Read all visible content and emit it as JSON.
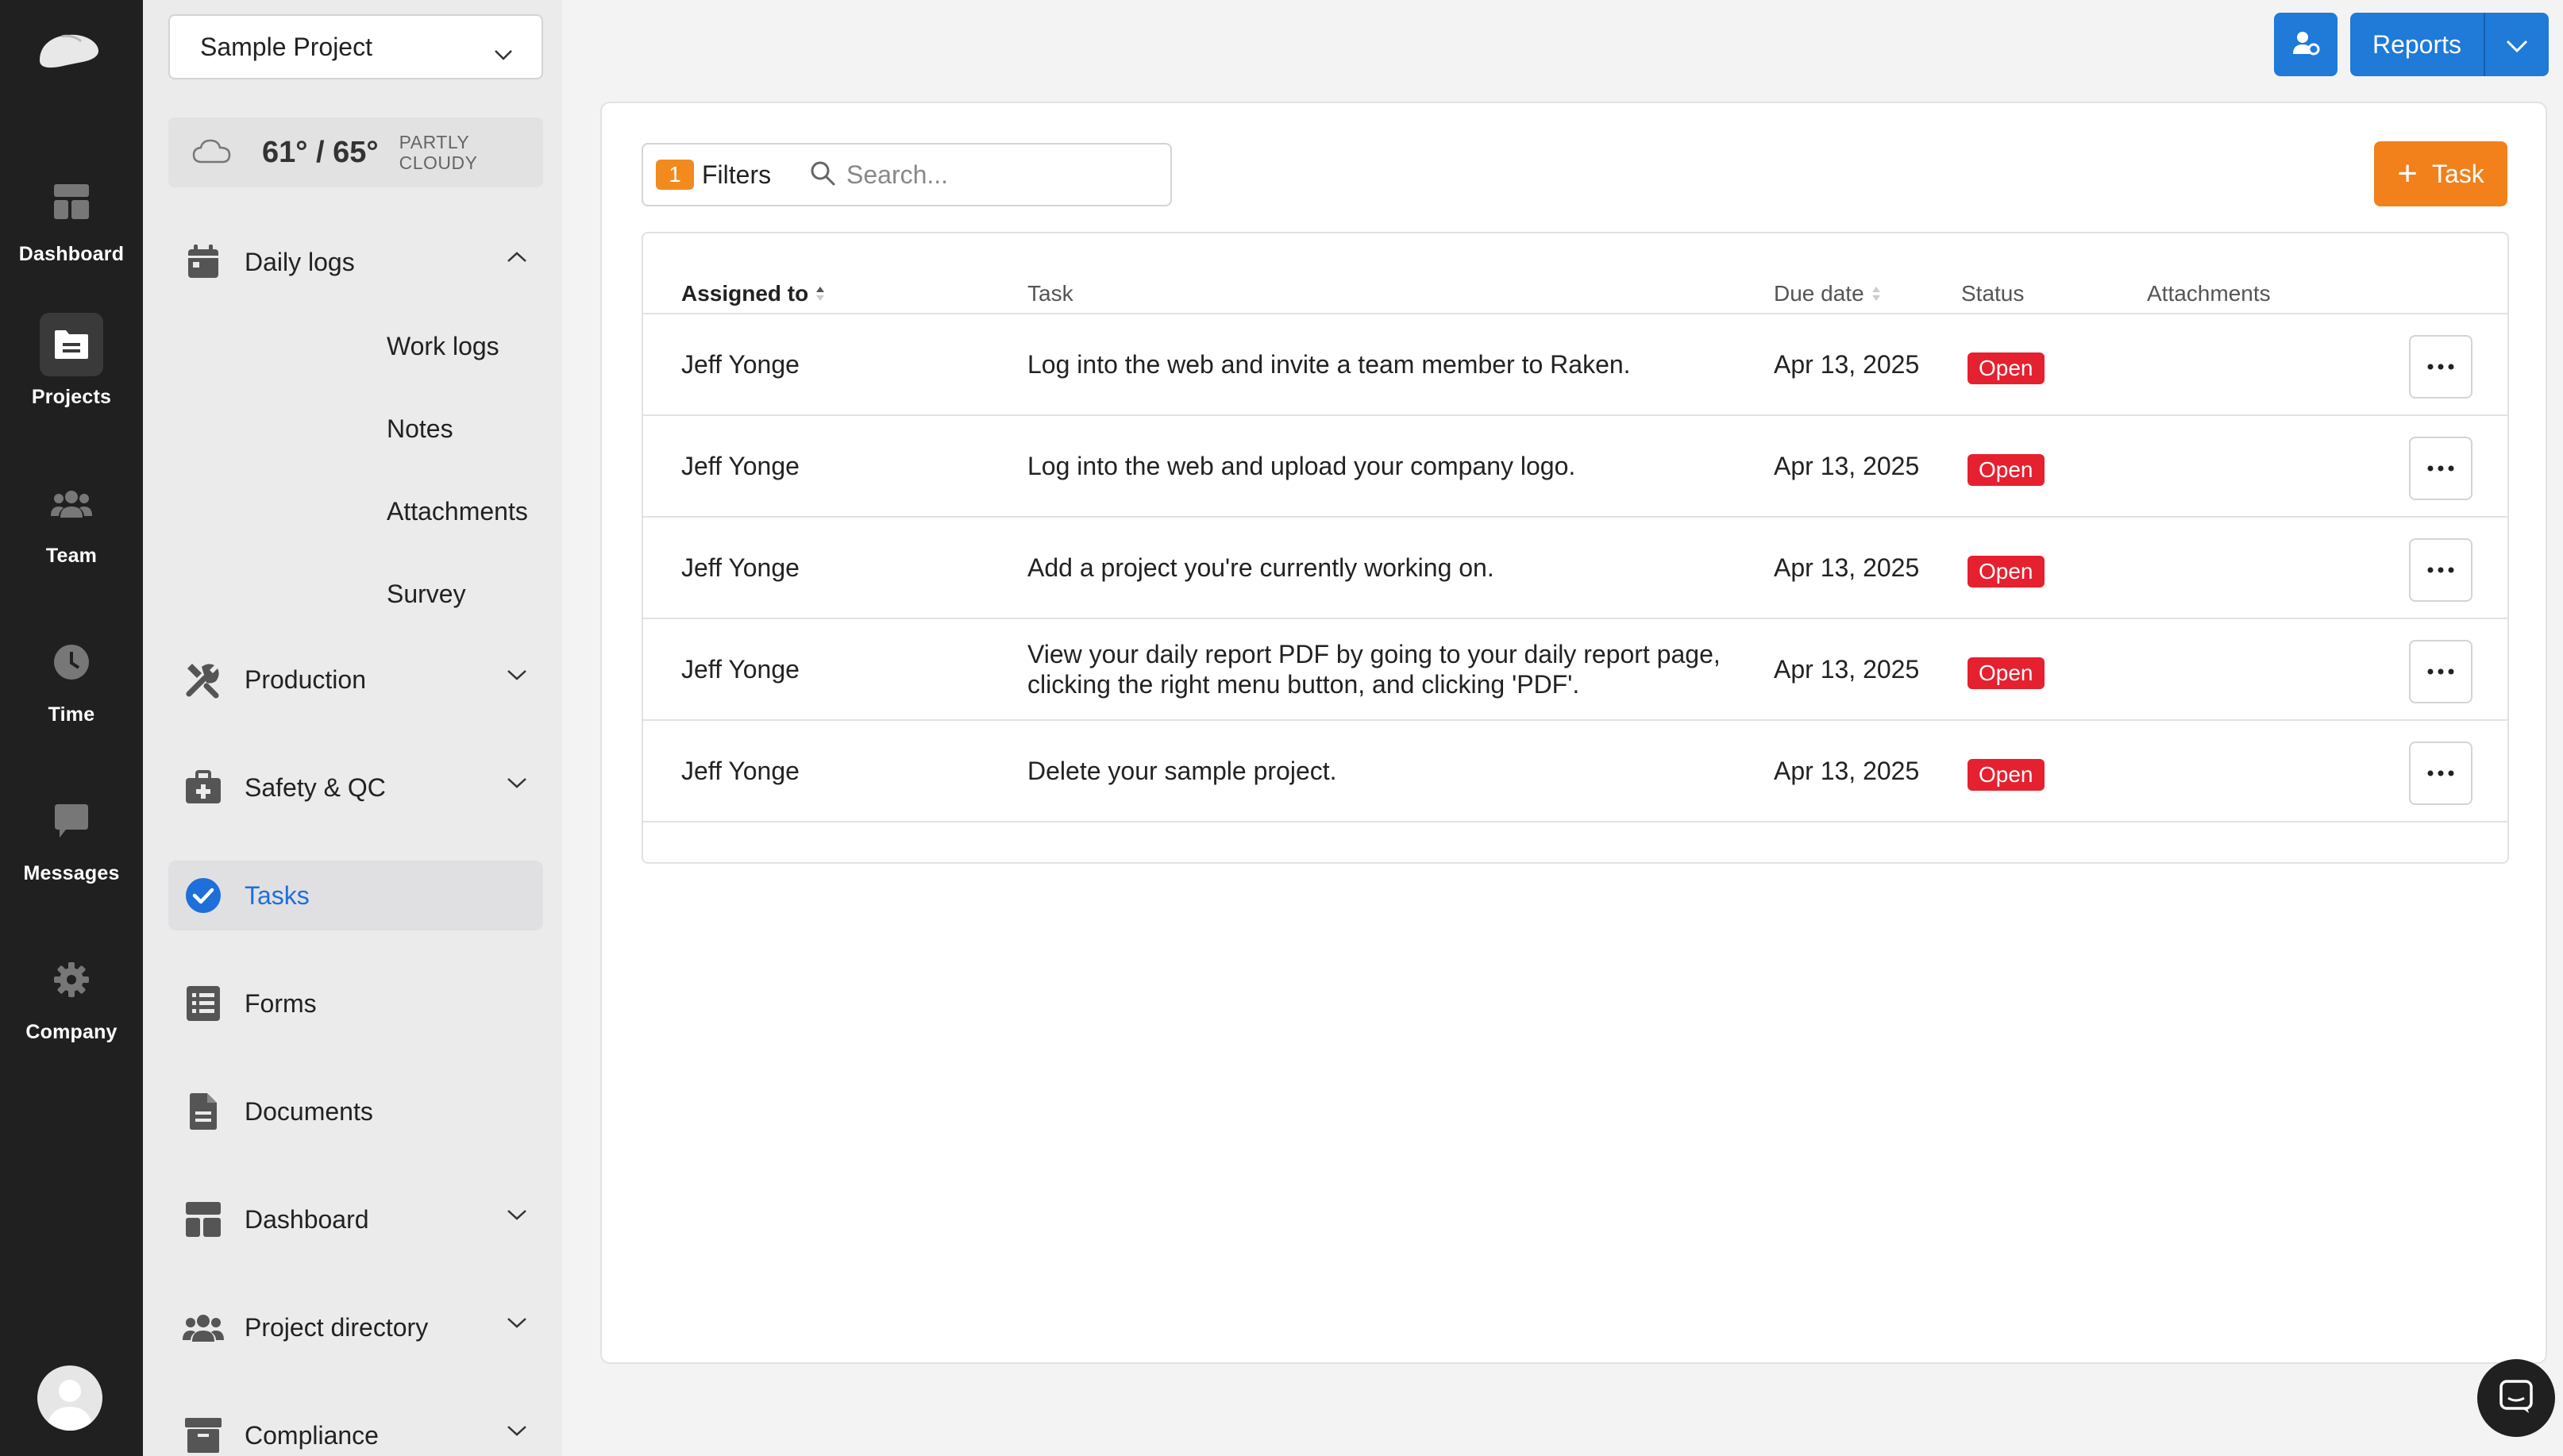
{
  "rail": {
    "items": [
      {
        "label": "Dashboard",
        "icon": "dashboard-icon"
      },
      {
        "label": "Projects",
        "icon": "folder-icon"
      },
      {
        "label": "Team",
        "icon": "team-icon"
      },
      {
        "label": "Time",
        "icon": "clock-icon"
      },
      {
        "label": "Messages",
        "icon": "chat-icon"
      },
      {
        "label": "Company",
        "icon": "gear-icon"
      }
    ],
    "active": "Projects"
  },
  "project": {
    "selected": "Sample Project"
  },
  "weather": {
    "temp": "61° / 65°",
    "condition": "PARTLY CLOUDY"
  },
  "nav": {
    "daily_logs": "Daily logs",
    "sub": [
      "Work logs",
      "Notes",
      "Attachments",
      "Survey"
    ],
    "production": "Production",
    "safety": "Safety & QC",
    "tasks": "Tasks",
    "forms": "Forms",
    "documents": "Documents",
    "dashboard": "Dashboard",
    "project_directory": "Project directory",
    "compliance": "Compliance"
  },
  "topbar": {
    "reports_label": "Reports"
  },
  "toolbar": {
    "filter_count": "1",
    "filters_label": "Filters",
    "search_placeholder": "Search...",
    "add_task_label": "Task"
  },
  "table": {
    "columns": {
      "assigned_to": "Assigned to",
      "task": "Task",
      "due_date": "Due date",
      "status": "Status",
      "attachments": "Attachments"
    },
    "rows": [
      {
        "assigned": "Jeff Yonge",
        "task": "Log into the web and invite a team member to Raken.",
        "due": "Apr 13, 2025",
        "status": "Open"
      },
      {
        "assigned": "Jeff Yonge",
        "task": "Log into the web and upload your company logo.",
        "due": "Apr 13, 2025",
        "status": "Open"
      },
      {
        "assigned": "Jeff Yonge",
        "task": "Add a project you're currently working on.",
        "due": "Apr 13, 2025",
        "status": "Open"
      },
      {
        "assigned": "Jeff Yonge",
        "task": "View your daily report PDF by going to your daily report page, clicking the right menu button, and clicking 'PDF'.",
        "due": "Apr 13, 2025",
        "status": "Open"
      },
      {
        "assigned": "Jeff Yonge",
        "task": "Delete your sample project.",
        "due": "Apr 13, 2025",
        "status": "Open"
      }
    ]
  },
  "colors": {
    "rail_bg": "#202020",
    "primary": "#1f7ad8",
    "accent": "#f2801b",
    "status_open": "#e5202f"
  }
}
